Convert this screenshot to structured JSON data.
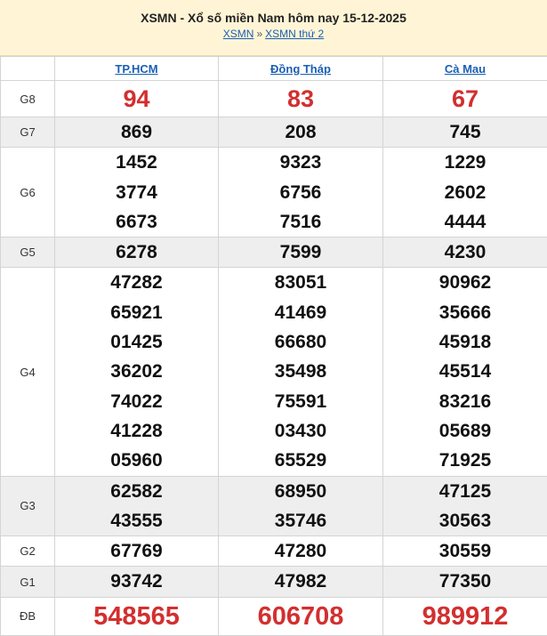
{
  "header": {
    "title": "XSMN - Xổ số miền Nam hôm nay 15-12-2025",
    "breadcrumb_1": "XSMN",
    "breadcrumb_sep": "»",
    "breadcrumb_2": "XSMN thứ 2"
  },
  "provinces": [
    "TP.HCM",
    "Đồng Tháp",
    "Cà Mau"
  ],
  "rows": [
    {
      "label": "G8",
      "style": "big",
      "values": [
        [
          "94"
        ],
        [
          "83"
        ],
        [
          "67"
        ]
      ]
    },
    {
      "label": "G7",
      "style": "num",
      "values": [
        [
          "869"
        ],
        [
          "208"
        ],
        [
          "745"
        ]
      ]
    },
    {
      "label": "G6",
      "style": "num",
      "values": [
        [
          "1452",
          "3774",
          "6673"
        ],
        [
          "9323",
          "6756",
          "7516"
        ],
        [
          "1229",
          "2602",
          "4444"
        ]
      ]
    },
    {
      "label": "G5",
      "style": "num",
      "values": [
        [
          "6278"
        ],
        [
          "7599"
        ],
        [
          "4230"
        ]
      ]
    },
    {
      "label": "G4",
      "style": "num",
      "values": [
        [
          "47282",
          "65921",
          "01425",
          "36202",
          "74022",
          "41228",
          "05960"
        ],
        [
          "83051",
          "41469",
          "66680",
          "35498",
          "75591",
          "03430",
          "65529"
        ],
        [
          "90962",
          "35666",
          "45918",
          "45514",
          "83216",
          "05689",
          "71925"
        ]
      ]
    },
    {
      "label": "G3",
      "style": "num",
      "values": [
        [
          "62582",
          "43555"
        ],
        [
          "68950",
          "35746"
        ],
        [
          "47125",
          "30563"
        ]
      ]
    },
    {
      "label": "G2",
      "style": "num",
      "values": [
        [
          "67769"
        ],
        [
          "47280"
        ],
        [
          "30559"
        ]
      ]
    },
    {
      "label": "G1",
      "style": "num",
      "values": [
        [
          "93742"
        ],
        [
          "47982"
        ],
        [
          "77350"
        ]
      ]
    },
    {
      "label": "ĐB",
      "style": "db",
      "values": [
        [
          "548565"
        ],
        [
          "606708"
        ],
        [
          "989912"
        ]
      ]
    }
  ],
  "colors": {
    "highlight": "#d32f2f",
    "link": "#1a5fb4",
    "header_bg": "#fff5d6",
    "alt_row_bg": "#eeeeee"
  }
}
